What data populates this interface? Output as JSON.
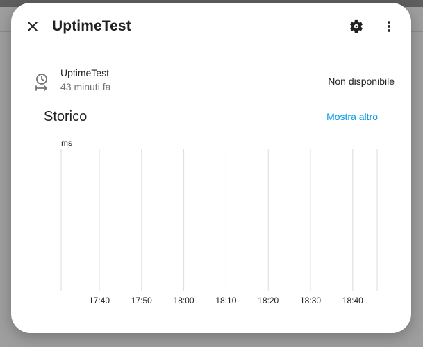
{
  "dialog": {
    "title": "UptimeTest"
  },
  "entity": {
    "name": "UptimeTest",
    "last_changed": "43 minuti fa",
    "state": "Non disponibile"
  },
  "history": {
    "section_title": "Storico",
    "more_link": "Mostra altro"
  },
  "chart_data": {
    "type": "line",
    "ylabel": "ms",
    "x_ticks": [
      "17:40",
      "17:50",
      "18:00",
      "18:10",
      "18:20",
      "18:30",
      "18:40"
    ],
    "series": []
  },
  "icons": {
    "close": "close-icon",
    "settings": "gear-icon",
    "more": "dots-vertical-icon",
    "entity": "clock-arrow-icon"
  }
}
